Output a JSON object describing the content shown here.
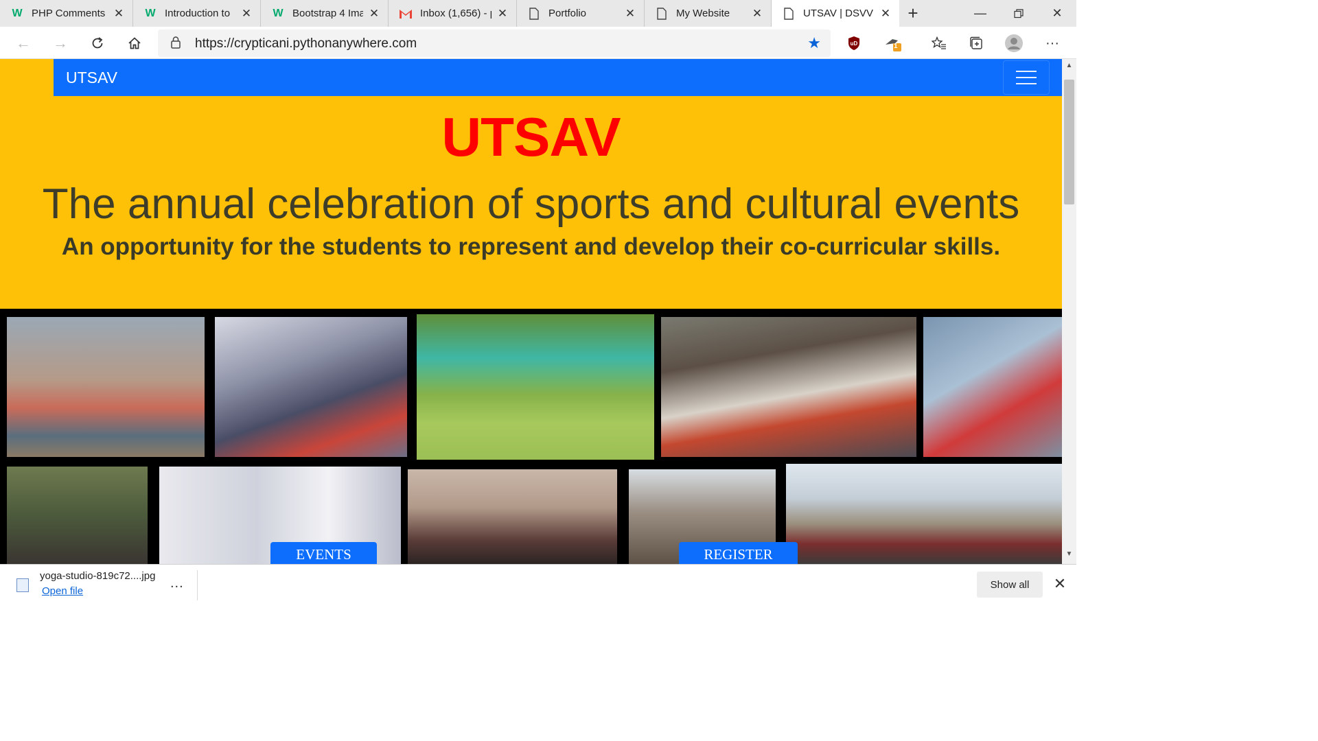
{
  "browser": {
    "tabs": [
      {
        "title": "PHP Comments",
        "icon": "w3schools-icon"
      },
      {
        "title": "Introduction to",
        "icon": "w3schools-icon"
      },
      {
        "title": "Bootstrap 4 Ima",
        "icon": "w3schools-icon"
      },
      {
        "title": "Inbox (1,656) - p",
        "icon": "gmail-icon"
      },
      {
        "title": "Portfolio",
        "icon": "page-icon"
      },
      {
        "title": "My Website",
        "icon": "page-icon"
      },
      {
        "title": "UTSAV | DSVV",
        "icon": "page-icon",
        "active": true
      }
    ],
    "url": "https://crypticani.pythonanywhere.com",
    "extension_badge": "1",
    "accent_color": "#0a64d8"
  },
  "site": {
    "brand": "UTSAV",
    "hero_title": "UTSAV",
    "hero_lead": "The annual celebration of sports and cultural events",
    "hero_sub": "An opportunity for the students to represent and develop their co-curricular skills.",
    "buttons": {
      "events": "EVENTS",
      "register": "REGISTER"
    },
    "colors": {
      "background": "#ffc107",
      "navbar": "#0d6efd",
      "title": "#ff0000"
    }
  },
  "download": {
    "filename": "yoga-studio-819c72....jpg",
    "open_label": "Open file",
    "more_label": "...",
    "show_all_label": "Show all"
  }
}
